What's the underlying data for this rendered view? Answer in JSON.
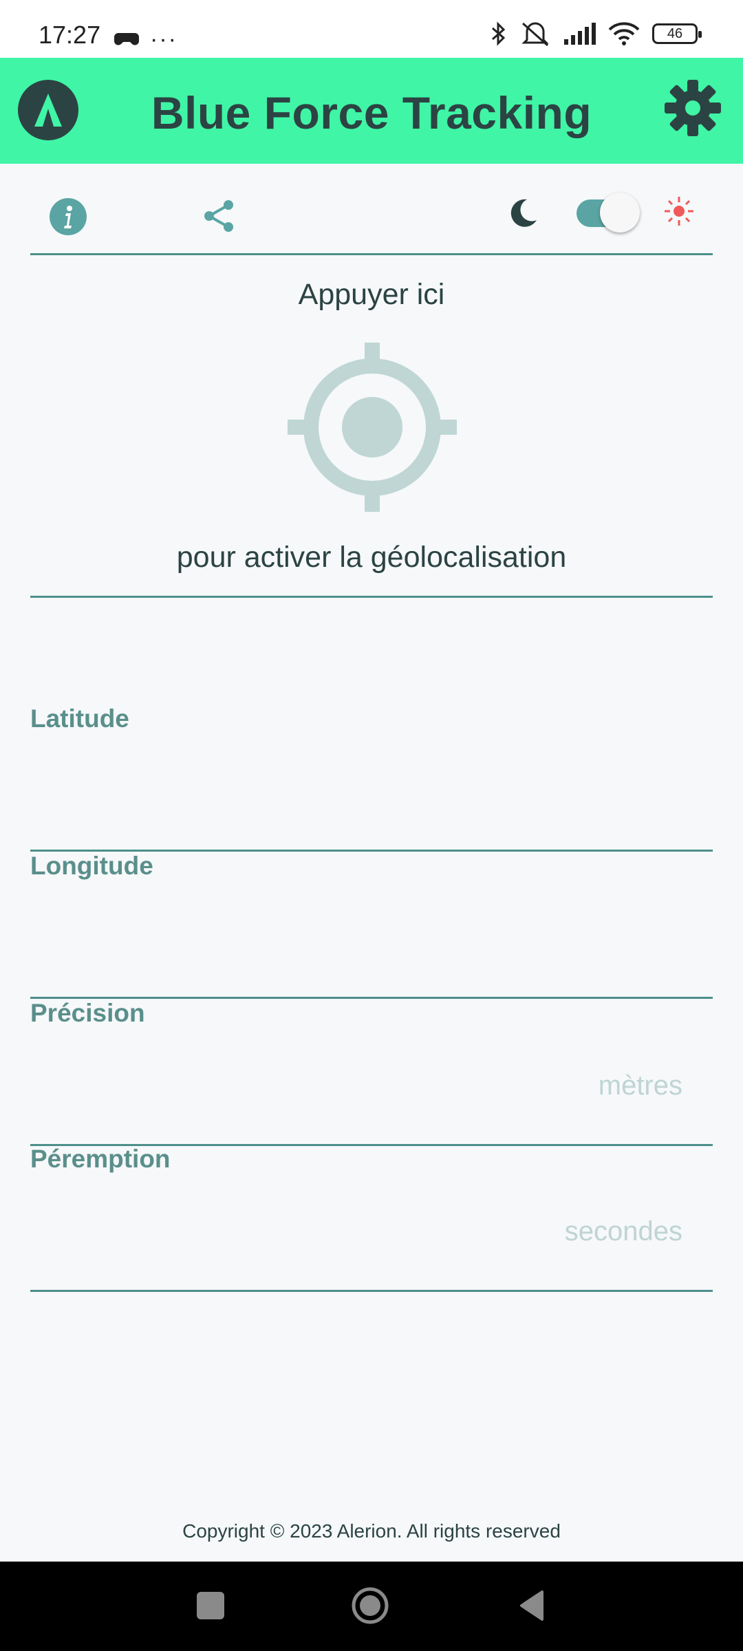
{
  "status_bar": {
    "time": "17:27",
    "dots": "···",
    "battery_level": "46"
  },
  "header": {
    "title": "Blue Force Tracking"
  },
  "geolocation": {
    "hint_top": "Appuyer ici",
    "hint_bottom": "pour activer la géolocalisation"
  },
  "fields": {
    "latitude": {
      "label": "Latitude",
      "value": ""
    },
    "longitude": {
      "label": "Longitude",
      "value": ""
    },
    "precision": {
      "label": "Précision",
      "unit": "mètres"
    },
    "expiry": {
      "label": "Péremption",
      "unit": "secondes"
    }
  },
  "footer": {
    "copyright": "Copyright © 2023 Alerion. All rights reserved"
  },
  "theme": {
    "mode_toggle": "on",
    "accent": "#40f5a6",
    "primary_dark": "#2c4343",
    "teal": "#5aa5a3"
  }
}
